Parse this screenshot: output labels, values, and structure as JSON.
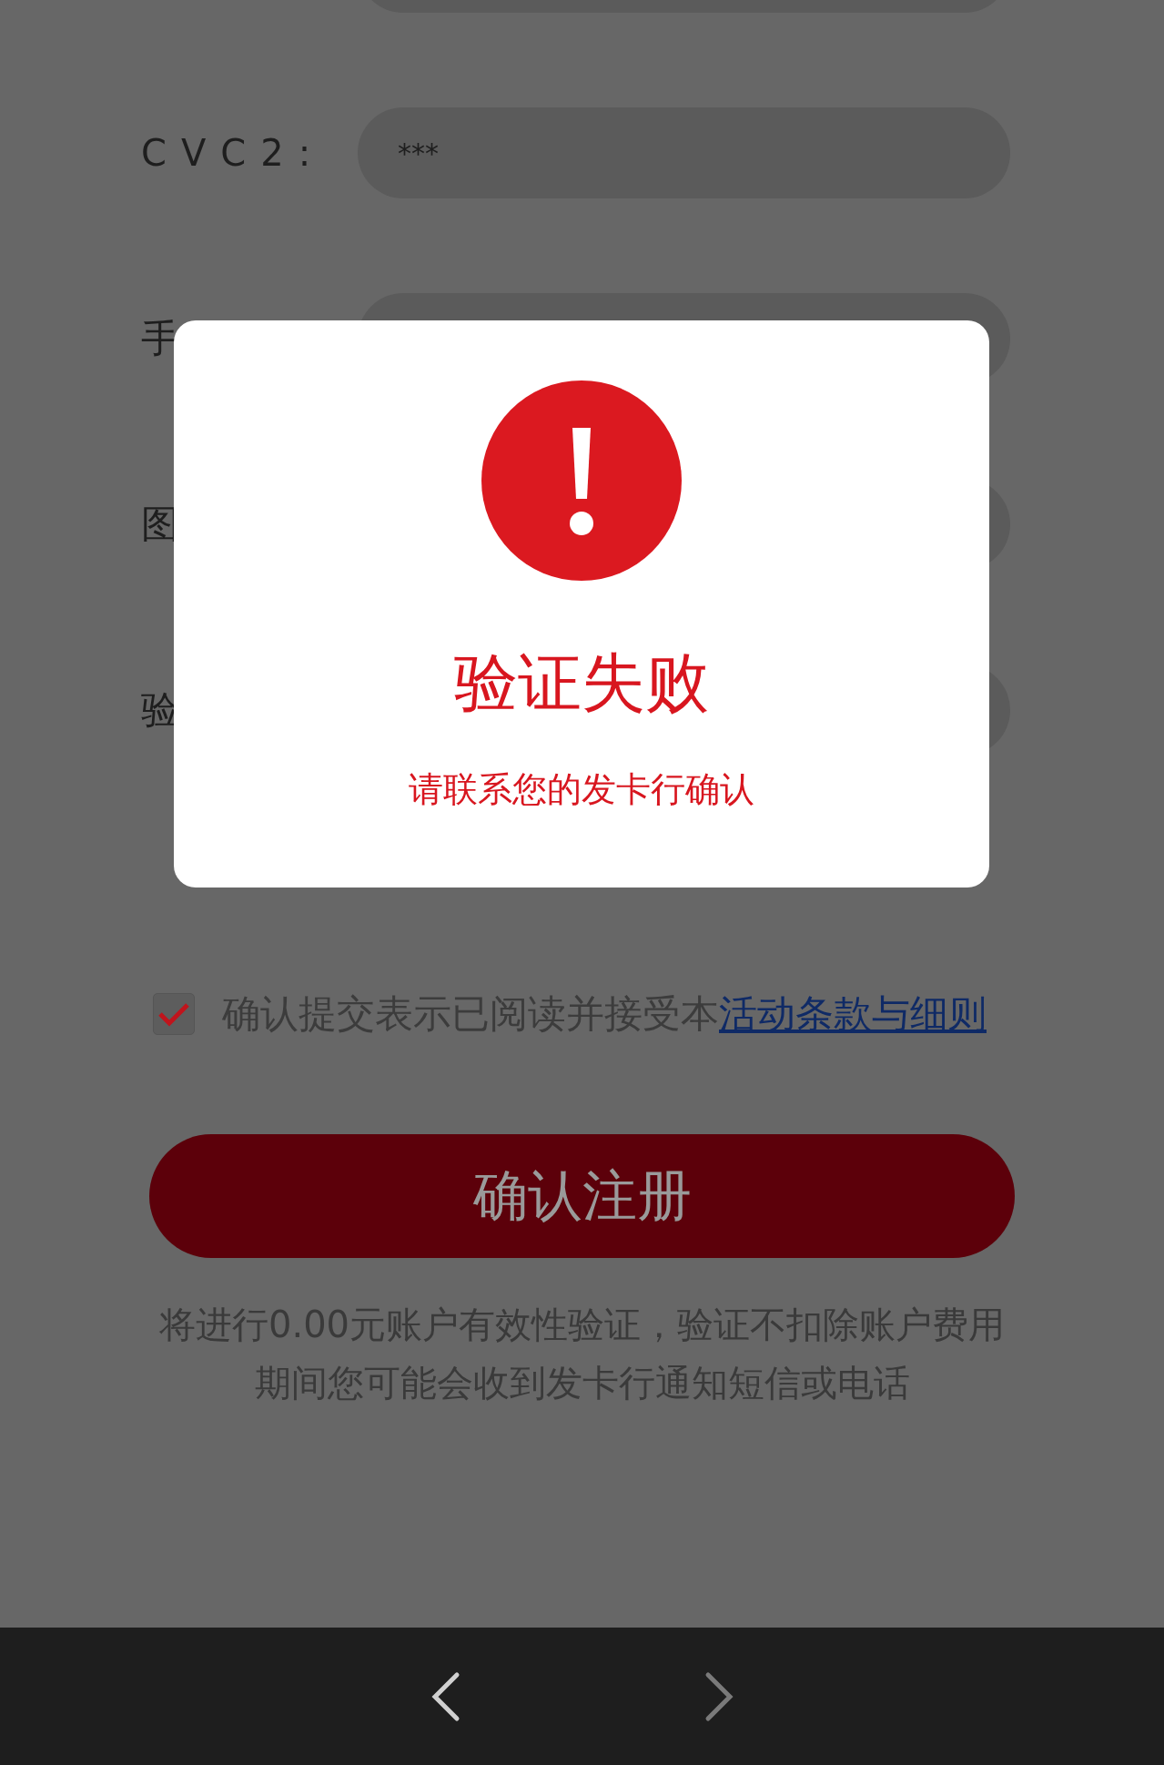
{
  "form": {
    "fields": [
      {
        "kind": "input"
      },
      {
        "kind": "input",
        "label": "CVC2:",
        "value": "***"
      },
      {
        "kind": "input",
        "label": "手"
      },
      {
        "kind": "input",
        "label": "图"
      },
      {
        "kind": "input",
        "label": "验"
      }
    ]
  },
  "agreement": {
    "checked": true,
    "text": "确认提交表示已阅读并接受本",
    "link": "活动条款与细则"
  },
  "submit_button": "确认注册",
  "notes": [
    "将进行0.00元账户有效性验证，验证不扣除账户费用",
    "期间您可能会收到发卡行通知短信或电话"
  ],
  "dialog": {
    "title": "验证失败",
    "message": "请联系您的发卡行确认"
  },
  "nav": [
    {
      "kind": "back",
      "disabled": false
    },
    {
      "kind": "forward",
      "disabled": true
    }
  ]
}
